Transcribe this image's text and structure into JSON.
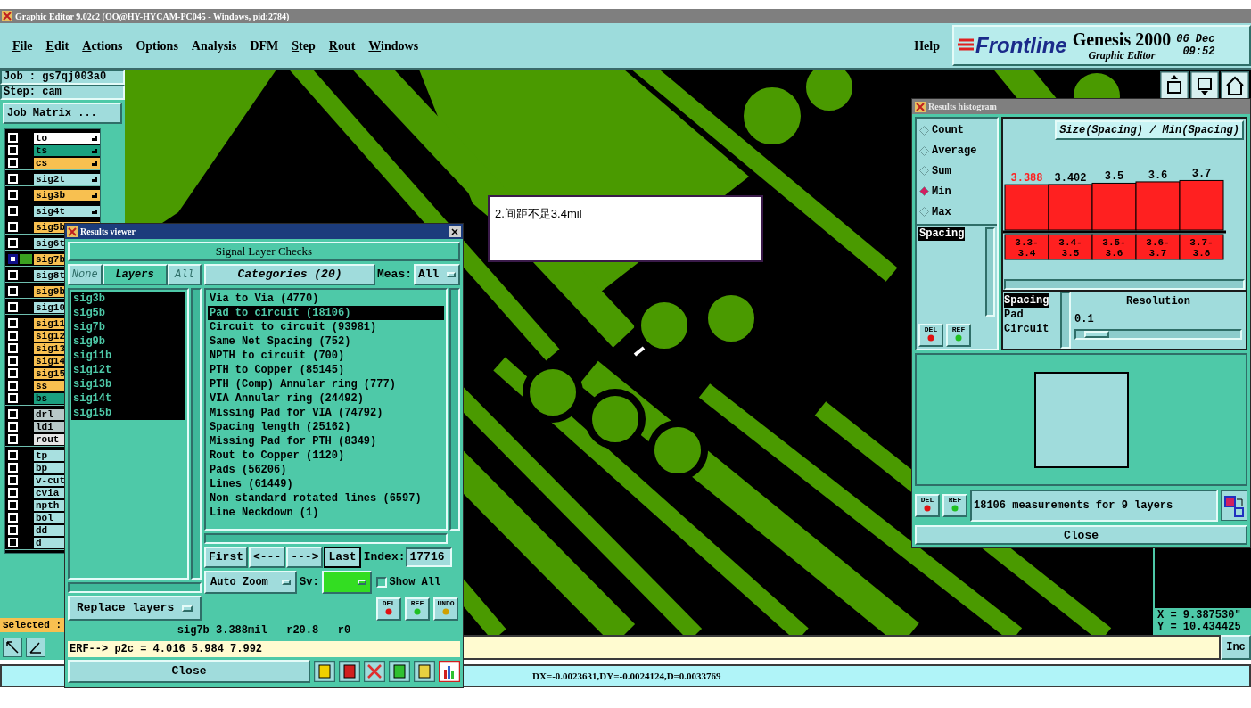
{
  "window": {
    "title": "Graphic Editor 9.02c2 (OO@HY-HYCAM-PC045 - Windows, pid:2784)"
  },
  "menu": [
    {
      "label": "File",
      "mnemonic": true
    },
    {
      "label": "Edit",
      "mnemonic": true
    },
    {
      "label": "Actions",
      "mnemonic": true
    },
    {
      "label": "Options",
      "mnemonic": false
    },
    {
      "label": "Analysis",
      "mnemonic": false
    },
    {
      "label": "DFM",
      "mnemonic": false
    },
    {
      "label": "Step",
      "mnemonic": true
    },
    {
      "label": "Rout",
      "mnemonic": true
    },
    {
      "label": "Windows",
      "mnemonic": true
    }
  ],
  "help": "Help",
  "brand": {
    "logo": "Frontline",
    "product": "Genesis 2000",
    "subtitle": "Graphic Editor",
    "date": "06 Dec",
    "time": "09:52"
  },
  "job": {
    "job": "Job : gs7qj003a0",
    "step": "Step: cam",
    "matrix_button": "Job Matrix ..."
  },
  "layer_groups": [
    [
      {
        "name": "to",
        "color": "#ffffff",
        "hand": true,
        "selected": false
      },
      {
        "name": "ts",
        "color": "#1aa080",
        "hand": true,
        "selected": false
      },
      {
        "name": "cs",
        "color": "#f8c050",
        "hand": true,
        "selected": false
      }
    ],
    [
      {
        "name": "sig2t",
        "color": "#a8e0e0",
        "hand": true,
        "selected": false
      }
    ],
    [
      {
        "name": "sig3b",
        "color": "#f8c050",
        "hand": true,
        "selected": false
      }
    ],
    [
      {
        "name": "sig4t",
        "color": "#a8e0e0",
        "hand": true,
        "selected": false
      }
    ],
    [
      {
        "name": "sig5b",
        "color": "#f8c050",
        "hand": false,
        "selected": false
      }
    ],
    [
      {
        "name": "sig6t",
        "color": "#a8e0e0",
        "hand": false,
        "selected": false
      }
    ],
    [
      {
        "name": "sig7b",
        "color": "#f8c050",
        "hand": false,
        "selected": true
      }
    ],
    [
      {
        "name": "sig8t",
        "color": "#a8e0e0",
        "hand": false,
        "selected": false
      }
    ],
    [
      {
        "name": "sig9b",
        "color": "#f8c050",
        "hand": false,
        "selected": false
      }
    ],
    [
      {
        "name": "sig10",
        "color": "#a8e0e0",
        "hand": false,
        "selected": false
      }
    ],
    [
      {
        "name": "sig11",
        "color": "#f8c050",
        "hand": false,
        "selected": false
      },
      {
        "name": "sig12",
        "color": "#f8c050",
        "hand": false,
        "selected": false
      },
      {
        "name": "sig13",
        "color": "#f8c050",
        "hand": false,
        "selected": false
      },
      {
        "name": "sig14",
        "color": "#f8c050",
        "hand": false,
        "selected": false
      },
      {
        "name": "sig15",
        "color": "#f8c050",
        "hand": false,
        "selected": false
      },
      {
        "name": "ss",
        "color": "#f8c050",
        "hand": false,
        "selected": false
      },
      {
        "name": "bs",
        "color": "#1aa080",
        "hand": false,
        "selected": false
      }
    ],
    [
      {
        "name": "drl",
        "color": "#b8c8c8",
        "hand": false,
        "selected": false
      },
      {
        "name": "ldi",
        "color": "#b8c8c8",
        "hand": false,
        "selected": false
      },
      {
        "name": "rout",
        "color": "#e4e4e4",
        "hand": false,
        "selected": false
      }
    ],
    [
      {
        "name": "tp",
        "color": "#a8e0e0",
        "hand": false,
        "selected": false
      },
      {
        "name": "bp",
        "color": "#a8e0e0",
        "hand": false,
        "selected": false
      },
      {
        "name": "v-cut",
        "color": "#a8e0e0",
        "hand": false,
        "selected": false
      },
      {
        "name": "cvia",
        "color": "#a8e0e0",
        "hand": false,
        "selected": false
      },
      {
        "name": "npth",
        "color": "#a8e0e0",
        "hand": false,
        "selected": false
      },
      {
        "name": "bol",
        "color": "#a8e0e0",
        "hand": false,
        "selected": false
      },
      {
        "name": "dd",
        "color": "#a8e0e0",
        "hand": false,
        "selected": false
      },
      {
        "name": "d",
        "color": "#a8e0e0",
        "hand": false,
        "selected": false
      }
    ]
  ],
  "selected_label": "Selected :",
  "annotation": "2.间距不足3.4mil",
  "coordinates": {
    "x": "X = 9.387530\"",
    "y": "Y = 10.434425"
  },
  "command_button": "Inc",
  "status": "DX=-0.0023631,DY=-0.0024124,D=0.0033769",
  "results_viewer": {
    "title": "Results viewer",
    "heading": "Signal Layer Checks",
    "layer_buttons": [
      {
        "label": "None",
        "selected": false
      },
      {
        "label": "Layers",
        "selected": true
      },
      {
        "label": "All",
        "selected": false
      }
    ],
    "layers": [
      {
        "name": "sig3b",
        "selected": true
      },
      {
        "name": "sig5b",
        "selected": true
      },
      {
        "name": "sig7b",
        "selected": true
      },
      {
        "name": "sig9b",
        "selected": true
      },
      {
        "name": "sig11b",
        "selected": true
      },
      {
        "name": "sig12t",
        "selected": true
      },
      {
        "name": "sig13b",
        "selected": true
      },
      {
        "name": "sig14t",
        "selected": true
      },
      {
        "name": "sig15b",
        "selected": true
      }
    ],
    "categories_button": "Categories (20)",
    "meas_label": "Meas:",
    "meas_value": "All",
    "categories": [
      {
        "label": "Via to Via (4770)",
        "selected": false
      },
      {
        "label": "Pad to circuit (18106)",
        "selected": true
      },
      {
        "label": "Circuit to circuit (93981)",
        "selected": false
      },
      {
        "label": "Same Net Spacing (752)",
        "selected": false
      },
      {
        "label": "NPTH to circuit (700)",
        "selected": false
      },
      {
        "label": "PTH to Copper (85145)",
        "selected": false
      },
      {
        "label": "PTH (Comp) Annular ring (777)",
        "selected": false
      },
      {
        "label": "VIA Annular ring (24492)",
        "selected": false
      },
      {
        "label": "Missing Pad for VIA (74792)",
        "selected": false
      },
      {
        "label": "Spacing length (25162)",
        "selected": false
      },
      {
        "label": "Missing Pad for PTH (8349)",
        "selected": false
      },
      {
        "label": "Rout to Copper (1120)",
        "selected": false
      },
      {
        "label": "Pads (56206)",
        "selected": false
      },
      {
        "label": "Lines (61449)",
        "selected": false
      },
      {
        "label": "Non standard rotated lines (6597)",
        "selected": false
      },
      {
        "label": "Line Neckdown (1)",
        "selected": false
      }
    ],
    "nav": [
      {
        "label": "First",
        "default": false
      },
      {
        "label": "<---",
        "default": false
      },
      {
        "label": "--->",
        "default": false
      },
      {
        "label": "Last",
        "default": true
      }
    ],
    "index_label": "Index:",
    "index_value": "17716",
    "zoom": "Auto Zoom",
    "sv_label": "Sv:",
    "show_all": {
      "label": "Show All",
      "checked": false
    },
    "replace": "Replace layers",
    "tools": [
      "DEL",
      "REF",
      "UNDO"
    ],
    "info": "sig7b 3.388mil   r20.8   r0",
    "erf": "ERF--> p2c = 4.016 5.984 7.992",
    "close": "Close"
  },
  "histogram": {
    "title": "Results histogram",
    "modes": [
      {
        "label": "Count",
        "selected": false
      },
      {
        "label": "Average",
        "selected": false
      },
      {
        "label": "Sum",
        "selected": false
      },
      {
        "label": "Min",
        "selected": true
      },
      {
        "label": "Max",
        "selected": false
      }
    ],
    "measures": [
      {
        "label": "Spacing",
        "selected": true
      }
    ],
    "tools": [
      "DEL",
      "REF"
    ],
    "highlighted": [
      true,
      false,
      false,
      false,
      false
    ],
    "chart_data": {
      "type": "bar",
      "title": "Size(Spacing) / Min(Spacing)",
      "categories": [
        "3.3-3.4",
        "3.4-3.5",
        "3.5-3.6",
        "3.6-3.7",
        "3.7-3.8"
      ],
      "series": [
        {
          "color": "#ff2020",
          "values": [
            3.388,
            3.402,
            3.5,
            3.6,
            3.7
          ]
        }
      ],
      "data_labels": true
    },
    "resolution_list": [
      {
        "label": "Spacing",
        "selected": true
      },
      {
        "label": "Pad",
        "selected": false
      },
      {
        "label": "Circuit",
        "selected": false
      }
    ],
    "resolution": {
      "title": "Resolution",
      "value": "0.1",
      "level": 0.05
    },
    "summary_tools": [
      "DEL",
      "REF"
    ],
    "summary": "18106 measurements for 9 layers",
    "close": "Close"
  }
}
